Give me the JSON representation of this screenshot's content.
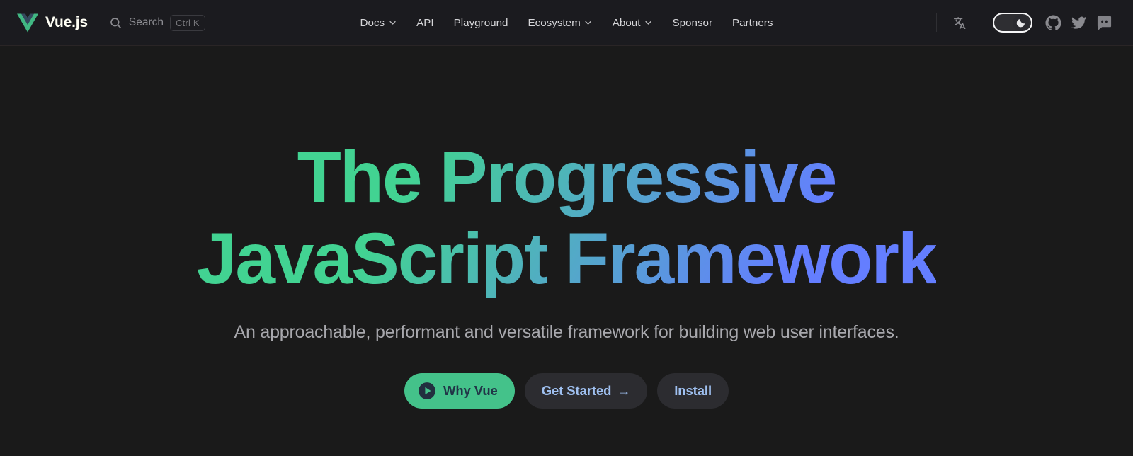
{
  "navbar": {
    "brand": {
      "logo_icon": "vue-logo-icon",
      "name": "Vue.js"
    },
    "search": {
      "icon": "search-icon",
      "label": "Search",
      "shortcut": "Ctrl K"
    },
    "menu": [
      {
        "label": "Docs",
        "has_dropdown": true
      },
      {
        "label": "API",
        "has_dropdown": false
      },
      {
        "label": "Playground",
        "has_dropdown": false
      },
      {
        "label": "Ecosystem",
        "has_dropdown": true
      },
      {
        "label": "About",
        "has_dropdown": true
      },
      {
        "label": "Sponsor",
        "has_dropdown": false
      },
      {
        "label": "Partners",
        "has_dropdown": false
      }
    ],
    "translate_icon": "translate-icon",
    "theme_toggle": {
      "icon": "moon-icon",
      "state": "dark"
    },
    "social": [
      {
        "name": "github-icon"
      },
      {
        "name": "twitter-icon"
      },
      {
        "name": "discord-icon"
      }
    ]
  },
  "hero": {
    "title_line1": "The Progressive",
    "title_line2": "JavaScript Framework",
    "tagline": "An approachable, performant and versatile framework for building web user interfaces.",
    "actions": [
      {
        "label": "Why Vue",
        "icon": "play-icon",
        "style": "primary"
      },
      {
        "label": "Get Started",
        "icon": "arrow-right-icon",
        "style": "secondary"
      },
      {
        "label": "Install",
        "icon": null,
        "style": "secondary"
      }
    ]
  },
  "colors": {
    "page_bg": "#1a1a1a",
    "nav_bg": "#1b1b1f",
    "gradient_start": "#42d392",
    "gradient_end": "#647eff",
    "brand_green": "#42b883",
    "brand_navy": "#35495e",
    "link_blue": "#9fc0f0"
  }
}
